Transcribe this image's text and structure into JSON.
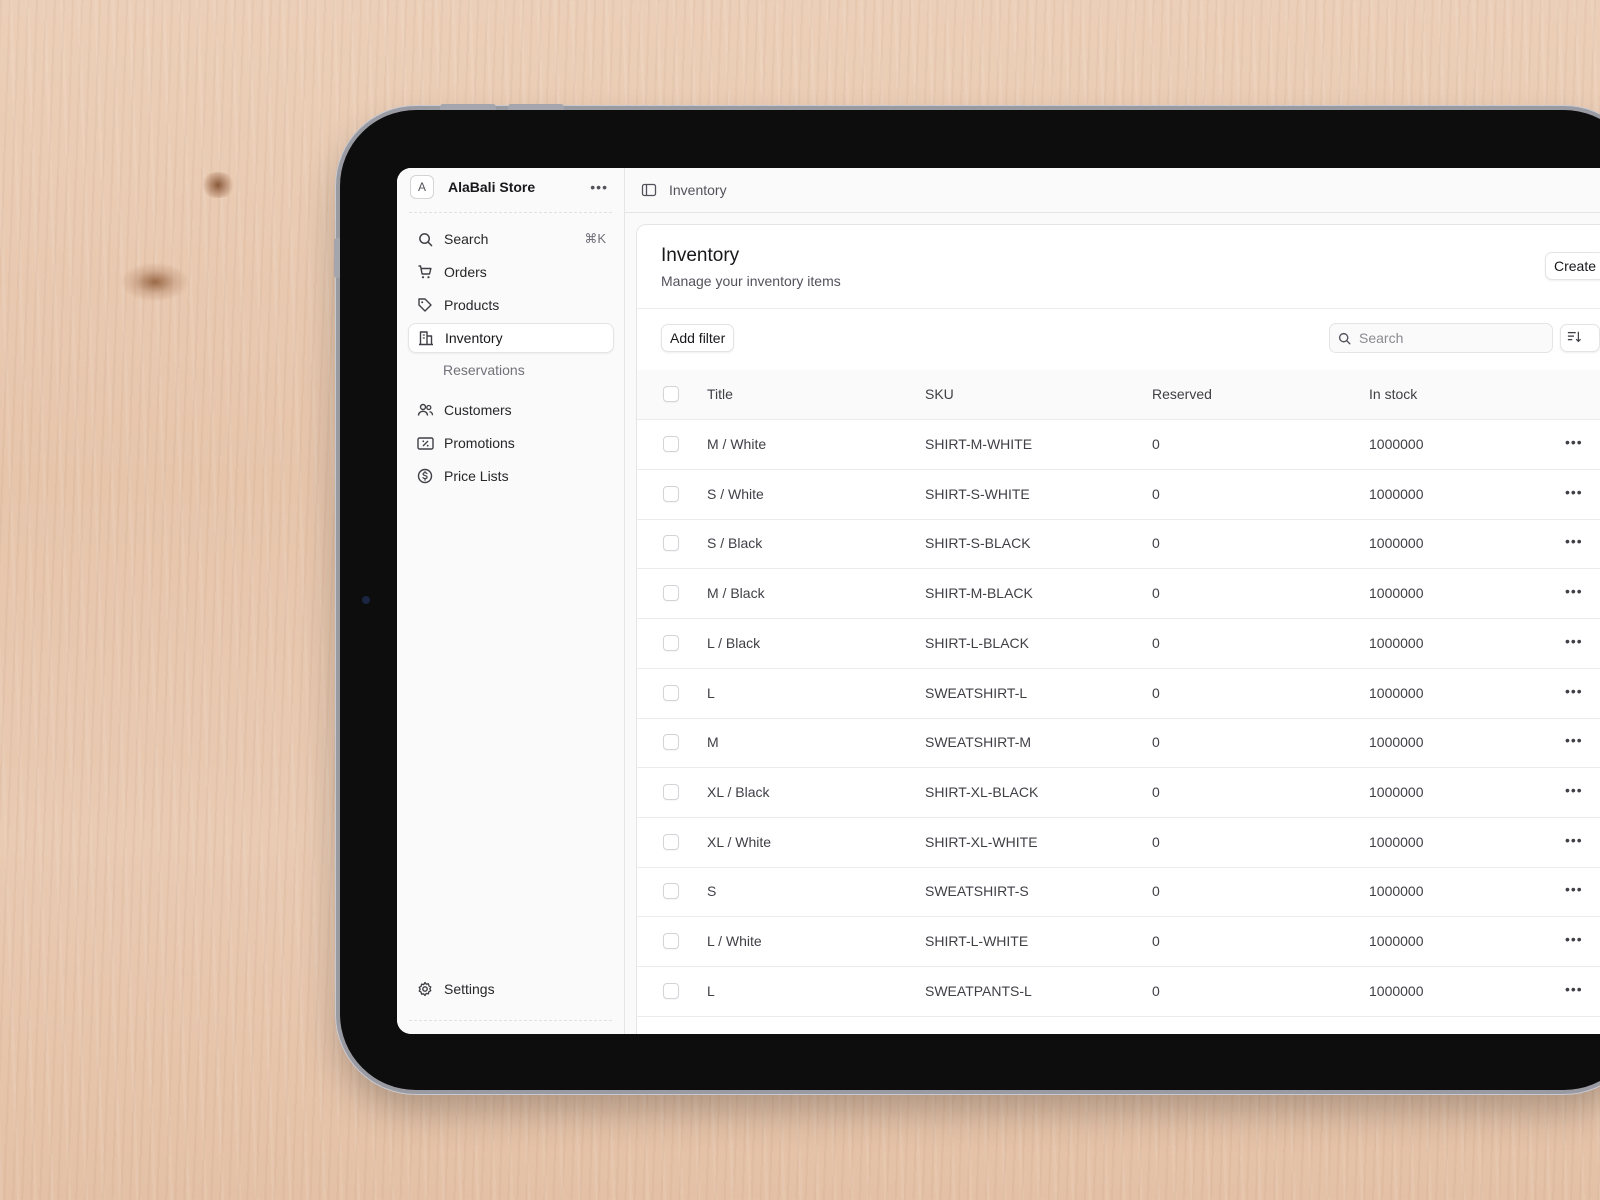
{
  "colors": {
    "background_wood": "#e9c9b0",
    "tablet_bezel": "#0d0d0e",
    "screen_bg": "#fafafa",
    "card_bg": "#ffffff",
    "text_primary": "#18181b",
    "text_secondary": "#52525b"
  },
  "sidebar": {
    "store_initial": "A",
    "store_name": "AlaBali Store",
    "store_menu_icon": "more-horizontal-icon",
    "search": {
      "label": "Search",
      "shortcut": "⌘K",
      "icon": "search-icon"
    },
    "items": [
      {
        "label": "Orders",
        "icon": "cart-icon"
      },
      {
        "label": "Products",
        "icon": "tag-icon"
      },
      {
        "label": "Inventory",
        "icon": "buildings-icon",
        "active": true
      },
      {
        "label": "Reservations",
        "sub": true
      },
      {
        "label": "Customers",
        "icon": "users-icon"
      },
      {
        "label": "Promotions",
        "icon": "receipt-percent-icon"
      },
      {
        "label": "Price Lists",
        "icon": "currency-dollar-icon"
      }
    ],
    "settings": {
      "label": "Settings",
      "icon": "cog-icon"
    }
  },
  "topbar": {
    "toggle_icon": "sidebar-toggle-icon",
    "breadcrumb": "Inventory"
  },
  "main": {
    "title": "Inventory",
    "subtitle": "Manage your inventory items",
    "create_label": "Create",
    "add_filter_label": "Add filter",
    "search_placeholder": "Search",
    "sort_icon": "sort-icon",
    "columns": [
      "Title",
      "SKU",
      "Reserved",
      "In stock"
    ],
    "rows": [
      {
        "title": "M / White",
        "sku": "SHIRT-M-WHITE",
        "reserved": "0",
        "in_stock": "1000000"
      },
      {
        "title": "S / White",
        "sku": "SHIRT-S-WHITE",
        "reserved": "0",
        "in_stock": "1000000"
      },
      {
        "title": "S / Black",
        "sku": "SHIRT-S-BLACK",
        "reserved": "0",
        "in_stock": "1000000"
      },
      {
        "title": "M / Black",
        "sku": "SHIRT-M-BLACK",
        "reserved": "0",
        "in_stock": "1000000"
      },
      {
        "title": "L / Black",
        "sku": "SHIRT-L-BLACK",
        "reserved": "0",
        "in_stock": "1000000"
      },
      {
        "title": "L",
        "sku": "SWEATSHIRT-L",
        "reserved": "0",
        "in_stock": "1000000"
      },
      {
        "title": "M",
        "sku": "SWEATSHIRT-M",
        "reserved": "0",
        "in_stock": "1000000"
      },
      {
        "title": "XL / Black",
        "sku": "SHIRT-XL-BLACK",
        "reserved": "0",
        "in_stock": "1000000"
      },
      {
        "title": "XL / White",
        "sku": "SHIRT-XL-WHITE",
        "reserved": "0",
        "in_stock": "1000000"
      },
      {
        "title": "S",
        "sku": "SWEATSHIRT-S",
        "reserved": "0",
        "in_stock": "1000000"
      },
      {
        "title": "L / White",
        "sku": "SHIRT-L-WHITE",
        "reserved": "0",
        "in_stock": "1000000"
      },
      {
        "title": "L",
        "sku": "SWEATPANTS-L",
        "reserved": "0",
        "in_stock": "1000000"
      }
    ]
  }
}
